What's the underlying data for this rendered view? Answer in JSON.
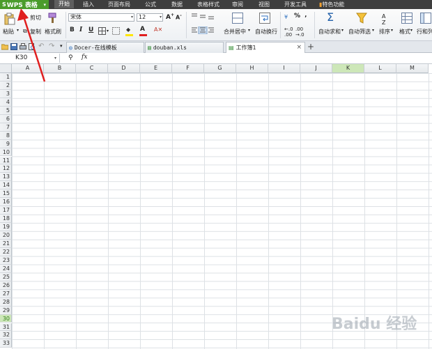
{
  "window": {
    "app_name": "WPS 表格",
    "menu": [
      "开始",
      "插入",
      "页面布局",
      "公式",
      "数据",
      "表格样式",
      "审阅",
      "视图",
      "开发工具",
      "特色功能"
    ],
    "active_menu_index": 0
  },
  "ribbon": {
    "clipboard": {
      "paste": "粘贴",
      "cut": "剪切",
      "copy": "复制",
      "format_painter": "格式刷"
    },
    "font": {
      "name": "宋体",
      "size": "12"
    },
    "format_buttons": [
      "B",
      "I",
      "U"
    ],
    "alignment": {
      "merge_center": "合并居中",
      "wrap_text": "自动换行"
    },
    "number": {
      "percent": "%",
      "comma": "‚"
    },
    "editing": {
      "autosum": "自动求和",
      "autofilter": "自动筛选",
      "sort": "排序",
      "format": "格式",
      "rows_cols": "行和列"
    }
  },
  "tabs": [
    {
      "label": "Docer-在线模板",
      "active": false
    },
    {
      "label": "douban.xls",
      "active": false
    },
    {
      "label": "工作簿1",
      "active": true
    }
  ],
  "formula_bar": {
    "cell_ref": "K30",
    "fx_label": "fx",
    "value": ""
  },
  "sheet": {
    "columns": [
      "A",
      "B",
      "C",
      "D",
      "E",
      "F",
      "G",
      "H",
      "I",
      "J",
      "K",
      "L",
      "M"
    ],
    "selected_column": "K",
    "rows": [
      "1",
      "2",
      "3",
      "4",
      "5",
      "6",
      "7",
      "8",
      "9",
      "10",
      "11",
      "12",
      "13",
      "14",
      "15",
      "16",
      "17",
      "18",
      "19",
      "20",
      "21",
      "22",
      "23",
      "24",
      "25",
      "26",
      "27",
      "28",
      "29",
      "30",
      "31",
      "32",
      "33"
    ],
    "selected_row": "30"
  },
  "colors": {
    "accent_green": "#4a9c2b",
    "menubar": "#3e3e3e",
    "annotation_red": "#e01f1f"
  },
  "watermark": "Baidu 经验"
}
